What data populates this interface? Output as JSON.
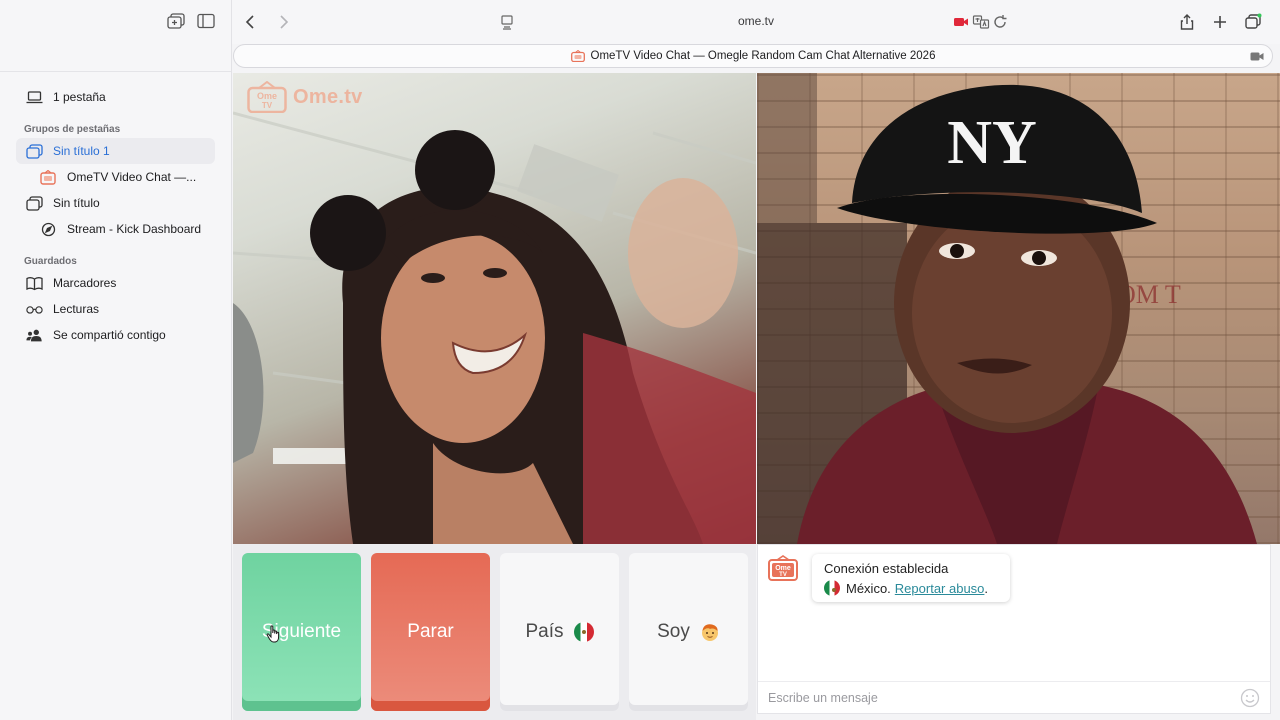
{
  "sidebar": {
    "tab_count": "1 pestaña",
    "groups_header": "Grupos de pestañas",
    "groups": [
      {
        "label": "Sin título 1",
        "selected": true
      },
      {
        "label": "OmeTV Video Chat —...",
        "child": true
      },
      {
        "label": "Sin título"
      },
      {
        "label": "Stream - Kick Dashboard",
        "child": true
      }
    ],
    "saved_header": "Guardados",
    "saved": [
      {
        "label": "Marcadores",
        "icon": "book-icon"
      },
      {
        "label": "Lecturas",
        "icon": "glasses-icon"
      },
      {
        "label": "Se compartió contigo",
        "icon": "people-icon"
      }
    ]
  },
  "toolbar": {
    "url": "ome.tv",
    "tab_title": "OmeTV Video Chat — Omegle Random Cam Chat Alternative 2026"
  },
  "video": {
    "logo_text": "Ome.tv",
    "logo_badge": "Ome TV"
  },
  "controls": {
    "next_label": "Siguiente",
    "stop_label": "Parar",
    "country_label": "País",
    "gender_label": "Soy"
  },
  "chat": {
    "status": "Conexión establecida",
    "country": "México.",
    "report": "Reportar abuso",
    "report_suffix": ".",
    "placeholder": "Escribe un mensaje"
  },
  "colors": {
    "accent_blue": "#2a6fd6",
    "next_green": "#6fd3a0",
    "stop_red": "#e56a55",
    "report_link": "#2a8a9a"
  }
}
